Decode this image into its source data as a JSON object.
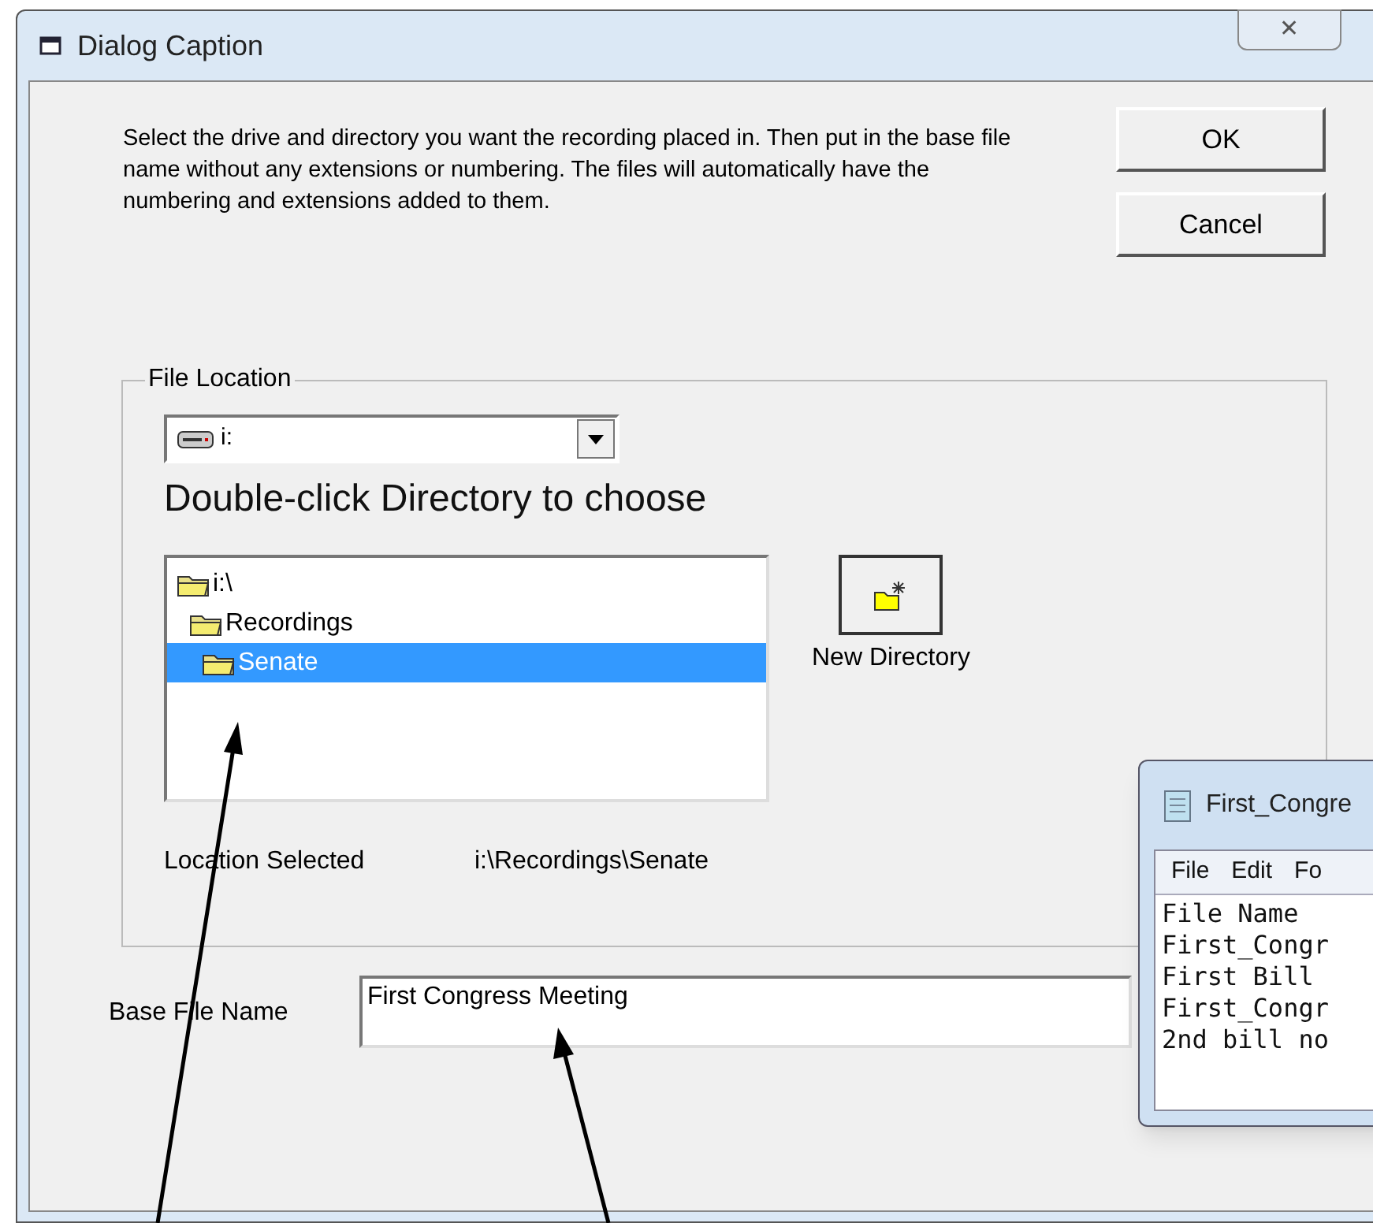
{
  "window": {
    "title": "Dialog Caption",
    "close": "✕"
  },
  "instructions": "Select the drive and directory you want the recording placed in.  Then put in the base file name without any extensions or numbering.  The files will automatically have the numbering and extensions added to them.",
  "buttons": [
    {
      "label": "OK"
    },
    {
      "label": "Cancel"
    }
  ],
  "file_location": {
    "title": "File Location",
    "drive": "i:",
    "hint": "Double-click Directory to choose",
    "tree": [
      {
        "label": "i:\\",
        "selected": false,
        "children": [
          {
            "label": "Recordings",
            "selected": false,
            "children": [
              {
                "label": "Senate",
                "selected": true
              }
            ]
          }
        ]
      }
    ],
    "new_directory": "New Directory",
    "location_label": "Location Selected",
    "location_value": "i:\\Recordings\\Senate"
  },
  "base_file_name": {
    "label": "Base File Name",
    "value": "First Congress Meeting"
  },
  "notepad": {
    "title": "First_Congre",
    "menu": [
      "File",
      "Edit",
      "Fo"
    ],
    "lines": [
      "File Name",
      "First_Congr",
      "First Bill",
      "First_Congr",
      "2nd bill no"
    ]
  }
}
